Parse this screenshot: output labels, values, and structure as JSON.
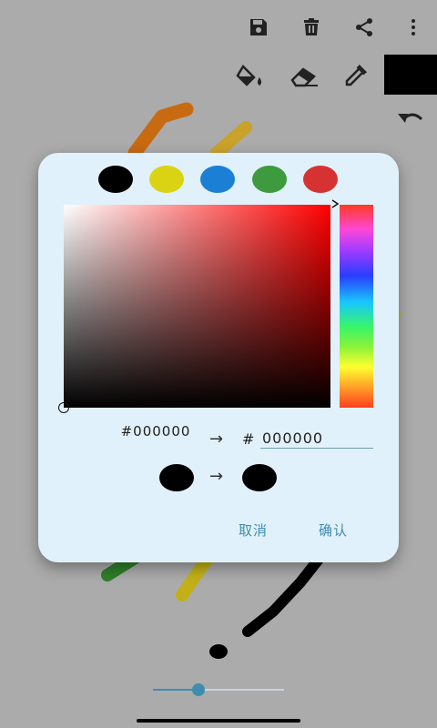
{
  "colors": {
    "background": "#ababab",
    "dialog_bg": "#e1f1fb",
    "accent": "#3f8dae",
    "current_color": "#000000"
  },
  "toolbar": {
    "icons": [
      "save-icon",
      "delete-icon",
      "share-icon",
      "more-icon"
    ],
    "tools": [
      "fill-bucket-icon",
      "eraser-icon",
      "eyedropper-icon"
    ],
    "current_color_swatch": "#000000",
    "undo": "undo-icon"
  },
  "dialog": {
    "preset_swatches": [
      "#000000",
      "#d9d314",
      "#1c7fd6",
      "#3d9a3d",
      "#d63232"
    ],
    "old_hex": "#000000",
    "arrow": "→",
    "hash": "#",
    "hex_value": "000000",
    "cancel_label": "取消",
    "confirm_label": "确认"
  },
  "brush_size_slider": {
    "value_fraction": 0.35
  }
}
